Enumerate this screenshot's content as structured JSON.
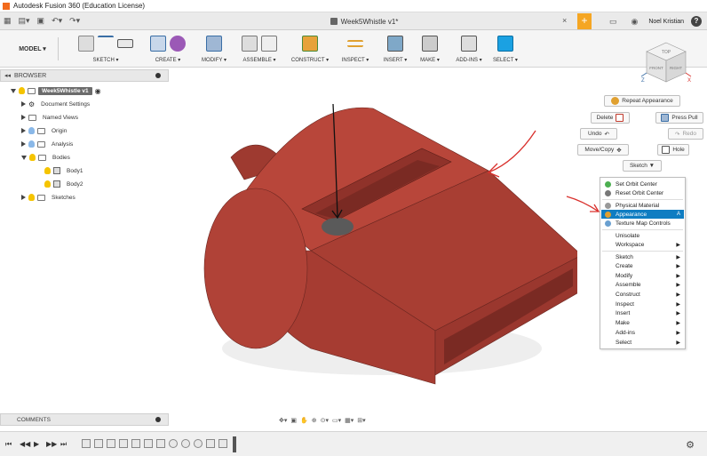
{
  "window": {
    "title": "Autodesk Fusion 360 (Education License)"
  },
  "tabbar": {
    "doc_title": "Week5Whistle v1*",
    "close": "×",
    "plus": "+",
    "user": "Noel Kristian",
    "help": "?"
  },
  "toolbar": {
    "workspace": "MODEL ▾",
    "groups": [
      {
        "label": "SKETCH ▾"
      },
      {
        "label": "CREATE ▾"
      },
      {
        "label": "MODIFY ▾"
      },
      {
        "label": "ASSEMBLE ▾"
      },
      {
        "label": "CONSTRUCT ▾"
      },
      {
        "label": "INSPECT ▾"
      },
      {
        "label": "INSERT ▾"
      },
      {
        "label": "MAKE ▾"
      },
      {
        "label": "ADD-INS ▾"
      },
      {
        "label": "SELECT ▾"
      }
    ]
  },
  "browser": {
    "header": "BROWSER",
    "items": [
      {
        "label": "Week5Whistle v1"
      },
      {
        "label": "Document Settings"
      },
      {
        "label": "Named Views"
      },
      {
        "label": "Origin"
      },
      {
        "label": "Analysis"
      },
      {
        "label": "Bodies"
      },
      {
        "label": "Body1"
      },
      {
        "label": "Body2"
      },
      {
        "label": "Sketches"
      }
    ]
  },
  "comments": {
    "label": "COMMENTS"
  },
  "marking_menu": {
    "repeat": "Repeat Appearance",
    "delete": "Delete",
    "presspull": "Press Pull",
    "undo": "Undo",
    "redo": "Redo",
    "movecopy": "Move/Copy",
    "hole": "Hole",
    "sketch": "Sketch ▼"
  },
  "context_menu": {
    "items": [
      {
        "label": "Set Orbit Center"
      },
      {
        "label": "Reset Orbit Center"
      },
      {
        "label": "Physical Material"
      },
      {
        "label": "Appearance",
        "shortcut": "A"
      },
      {
        "label": "Texture Map Controls"
      },
      {
        "label": "Unisolate"
      },
      {
        "label": "Workspace"
      },
      {
        "label": "Sketch"
      },
      {
        "label": "Create"
      },
      {
        "label": "Modify"
      },
      {
        "label": "Assemble"
      },
      {
        "label": "Construct"
      },
      {
        "label": "Inspect"
      },
      {
        "label": "Insert"
      },
      {
        "label": "Make"
      },
      {
        "label": "Add-ins"
      },
      {
        "label": "Select"
      }
    ]
  },
  "viewcube": {
    "top": "TOP",
    "front": "FRONT",
    "right": "RIGHT"
  },
  "colors": {
    "model": "#b8463a",
    "accent": "#0f7dc2",
    "annotation": "#d9302c"
  }
}
